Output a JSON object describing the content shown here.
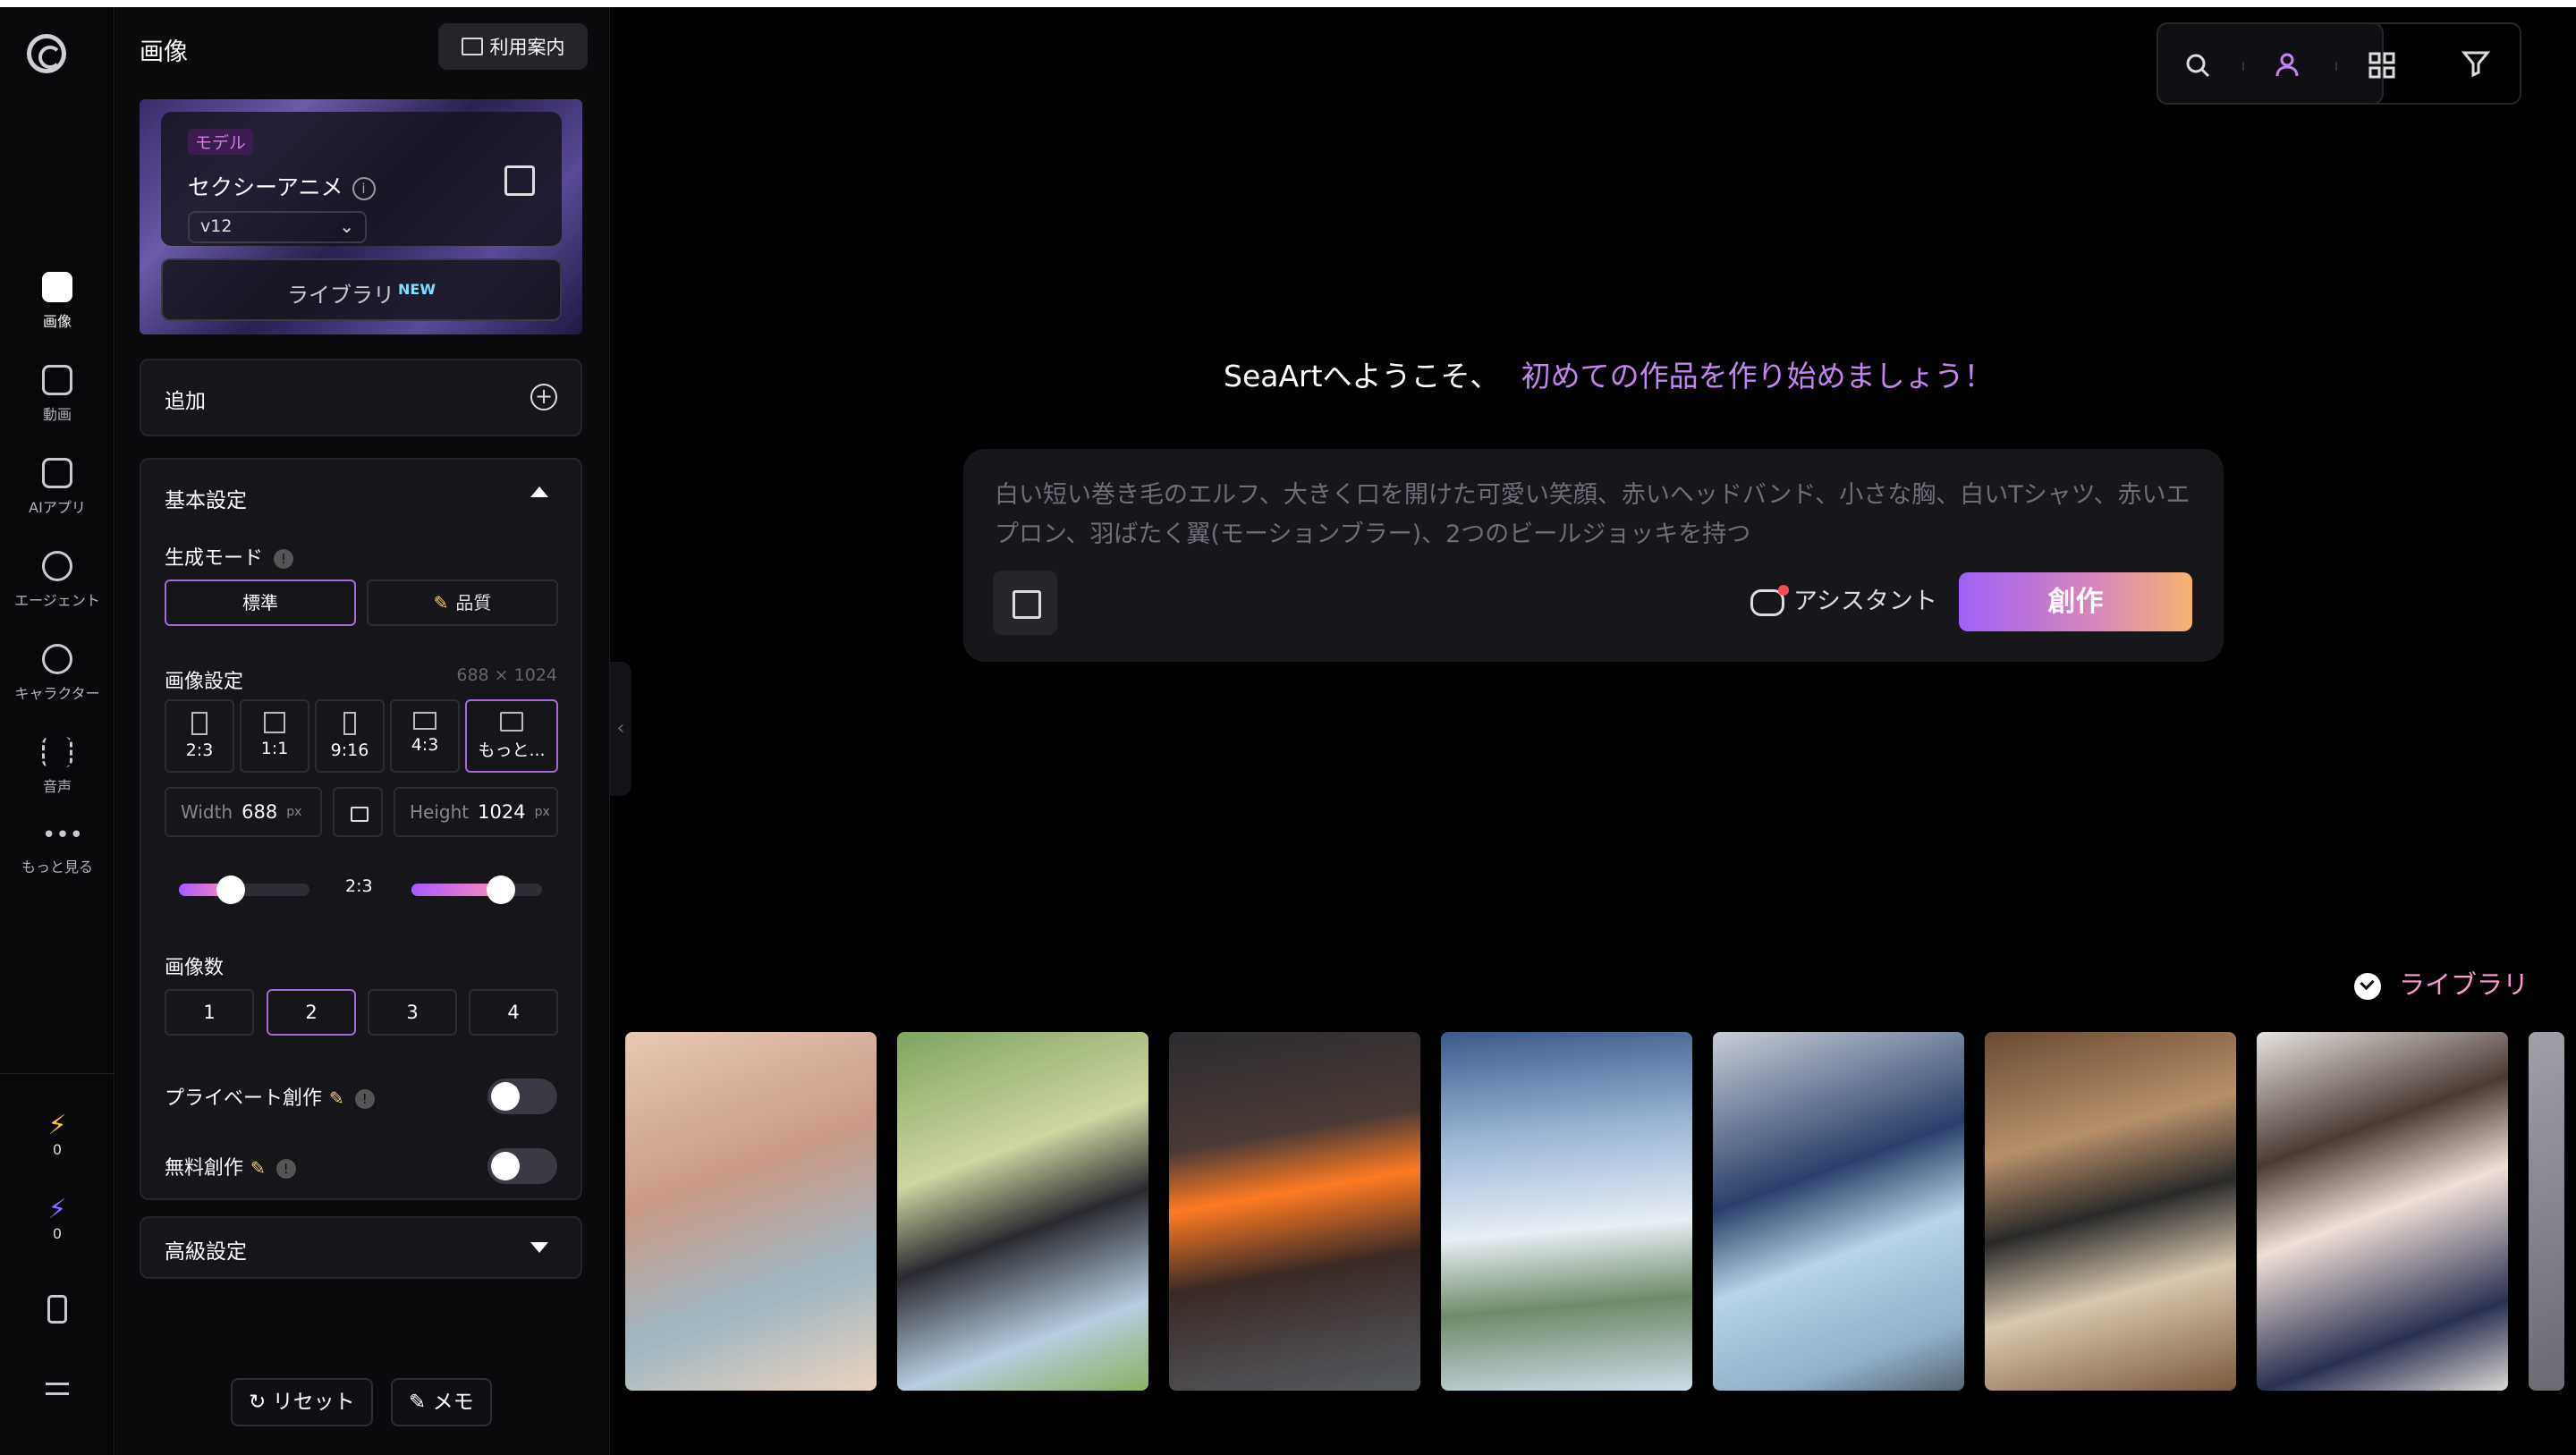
{
  "nav": {
    "items": [
      {
        "label": "画像",
        "icon": "image-icon"
      },
      {
        "label": "動画",
        "icon": "video-icon"
      },
      {
        "label": "AIアプリ",
        "icon": "ai-app-icon"
      },
      {
        "label": "エージェント",
        "icon": "agent-icon"
      },
      {
        "label": "キャラクター",
        "icon": "character-icon"
      },
      {
        "label": "音声",
        "icon": "audio-icon"
      },
      {
        "label": "もっと見る",
        "icon": "more-icon"
      }
    ],
    "stat_lightning": "0",
    "stat_power": "0"
  },
  "panel": {
    "title": "画像",
    "guide_label": "利用案内",
    "model": {
      "tag": "モデル",
      "name": "セクシーアニメ",
      "version": "v12",
      "library_label": "ライブラリ",
      "new_badge": "NEW"
    },
    "add_label": "追加",
    "basic_settings": "基本設定",
    "gen_mode_label": "生成モード",
    "mode_standard": "標準",
    "mode_quality": "品質",
    "image_settings_label": "画像設定",
    "dimension_text": "688 × 1024",
    "ratios": [
      "2:3",
      "1:1",
      "9:16",
      "4:3",
      "もっと..."
    ],
    "width_label": "Width",
    "width_value": "688",
    "height_label": "Height",
    "height_value": "1024",
    "unit": "px",
    "ratio_display": "2:3",
    "image_count_label": "画像数",
    "counts": [
      "1",
      "2",
      "3",
      "4"
    ],
    "private_label": "プライベート創作",
    "free_label": "無料創作",
    "advanced_label": "高級設定",
    "reset_label": "リセット",
    "memo_label": "メモ"
  },
  "main": {
    "welcome_prefix": "SeaArtへようこそ、",
    "welcome_highlight": "初めての作品を作り始めましょう！",
    "prompt_placeholder": "白い短い巻き毛のエルフ、大きく口を開けた可愛い笑顔、赤いヘッドバンド、小さな胸、白いTシャツ、赤いエプロン、羽ばたく翼(モーションブラー)、2つのビールジョッキを持つ",
    "assistant_label": "アシスタント",
    "create_label": "創作",
    "library_link": "ライブラリ"
  },
  "colors": {
    "accent": "#a86ad8",
    "highlight": "#c285f0",
    "library_pink": "#ff9ad1"
  }
}
